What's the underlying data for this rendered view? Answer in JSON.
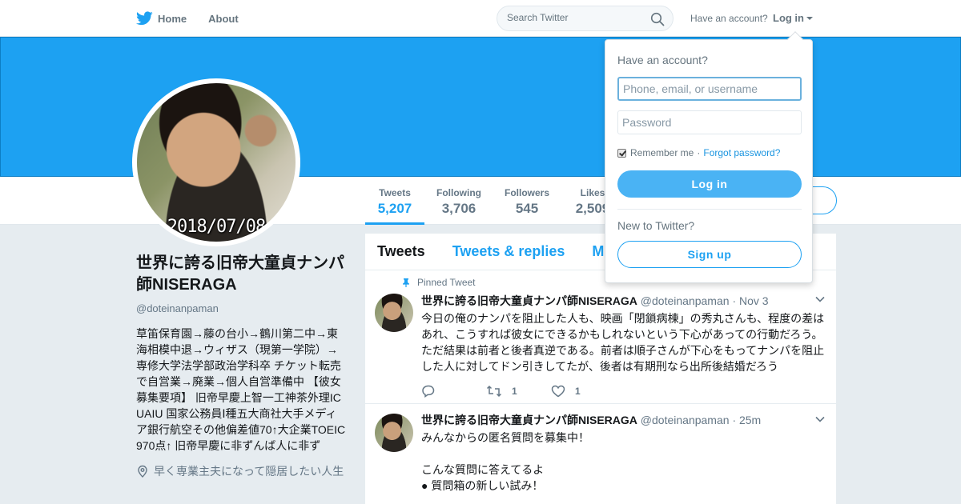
{
  "nav": {
    "home_label": "Home",
    "about_label": "About",
    "search_placeholder": "Search Twitter",
    "have_account": "Have an account?",
    "login_label": "Log in"
  },
  "avatar": {
    "stamp": "2018/07/08"
  },
  "stats": [
    {
      "label": "Tweets",
      "value": "5,207",
      "active": true
    },
    {
      "label": "Following",
      "value": "3,706"
    },
    {
      "label": "Followers",
      "value": "545"
    },
    {
      "label": "Likes",
      "value": "2,509"
    }
  ],
  "profile": {
    "name": "世界に誇る旧帝大童貞ナンパ師NISERAGA",
    "handle": "@doteinanpaman",
    "bio": "草笛保育園→藤の台小→鶴川第二中→東海相模中退→ウィザス（現第一学院）→専修大学法学部政治学科卒 チケット転売で自営業→廃業→個人自営準備中 【彼女募集要項】 旧帝早慶上智一工神茶外理ICUAIU 国家公務員Ⅰ種五大商社大手メディア銀行航空その他偏差値70↑大企業TOEIC970点↑ 旧帝早慶に非ずんば人に非ず",
    "location": "早く専業主夫になって隠居したい人生"
  },
  "timeline": {
    "tabs": [
      "Tweets",
      "Tweets & replies",
      "Media"
    ],
    "tweets": [
      {
        "pinned_label": "Pinned Tweet",
        "name": "世界に誇る旧帝大童貞ナンパ師NISERAGA",
        "handle": "@doteinanpaman",
        "time": "· Nov 3",
        "text": "今日の俺のナンパを阻止した人も、映画「閉鎖病棟」の秀丸さんも、程度の差はあれ、こうすれば彼女にできるかもしれないという下心があっての行動だろう。ただ結果は前者と後者真逆である。前者は順子さんが下心をもってナンパを阻止した人に対してドン引きしてたが、後者は有期刑なら出所後結婚だろう",
        "retweets": "1",
        "likes": "1"
      },
      {
        "name": "世界に誇る旧帝大童貞ナンパ師NISERAGA",
        "handle": "@doteinanpaman",
        "time": "· 25m",
        "line1": "みんなからの匿名質問を募集中！",
        "line2": "こんな質問に答えてるよ",
        "line3": "● 質問箱の新しい試み！"
      }
    ]
  },
  "login_dropdown": {
    "title": "Have an account?",
    "username_placeholder": "Phone, email, or username",
    "password_placeholder": "Password",
    "remember_me": "Remember me",
    "separator": "·",
    "forgot_password": "Forgot password?",
    "login_button": "Log in",
    "new_to_twitter": "New to Twitter?",
    "signup_button": "Sign up"
  },
  "colors": {
    "brand": "#1da1f2",
    "banner": "#1da1f2",
    "button": "#4ab3f4"
  }
}
